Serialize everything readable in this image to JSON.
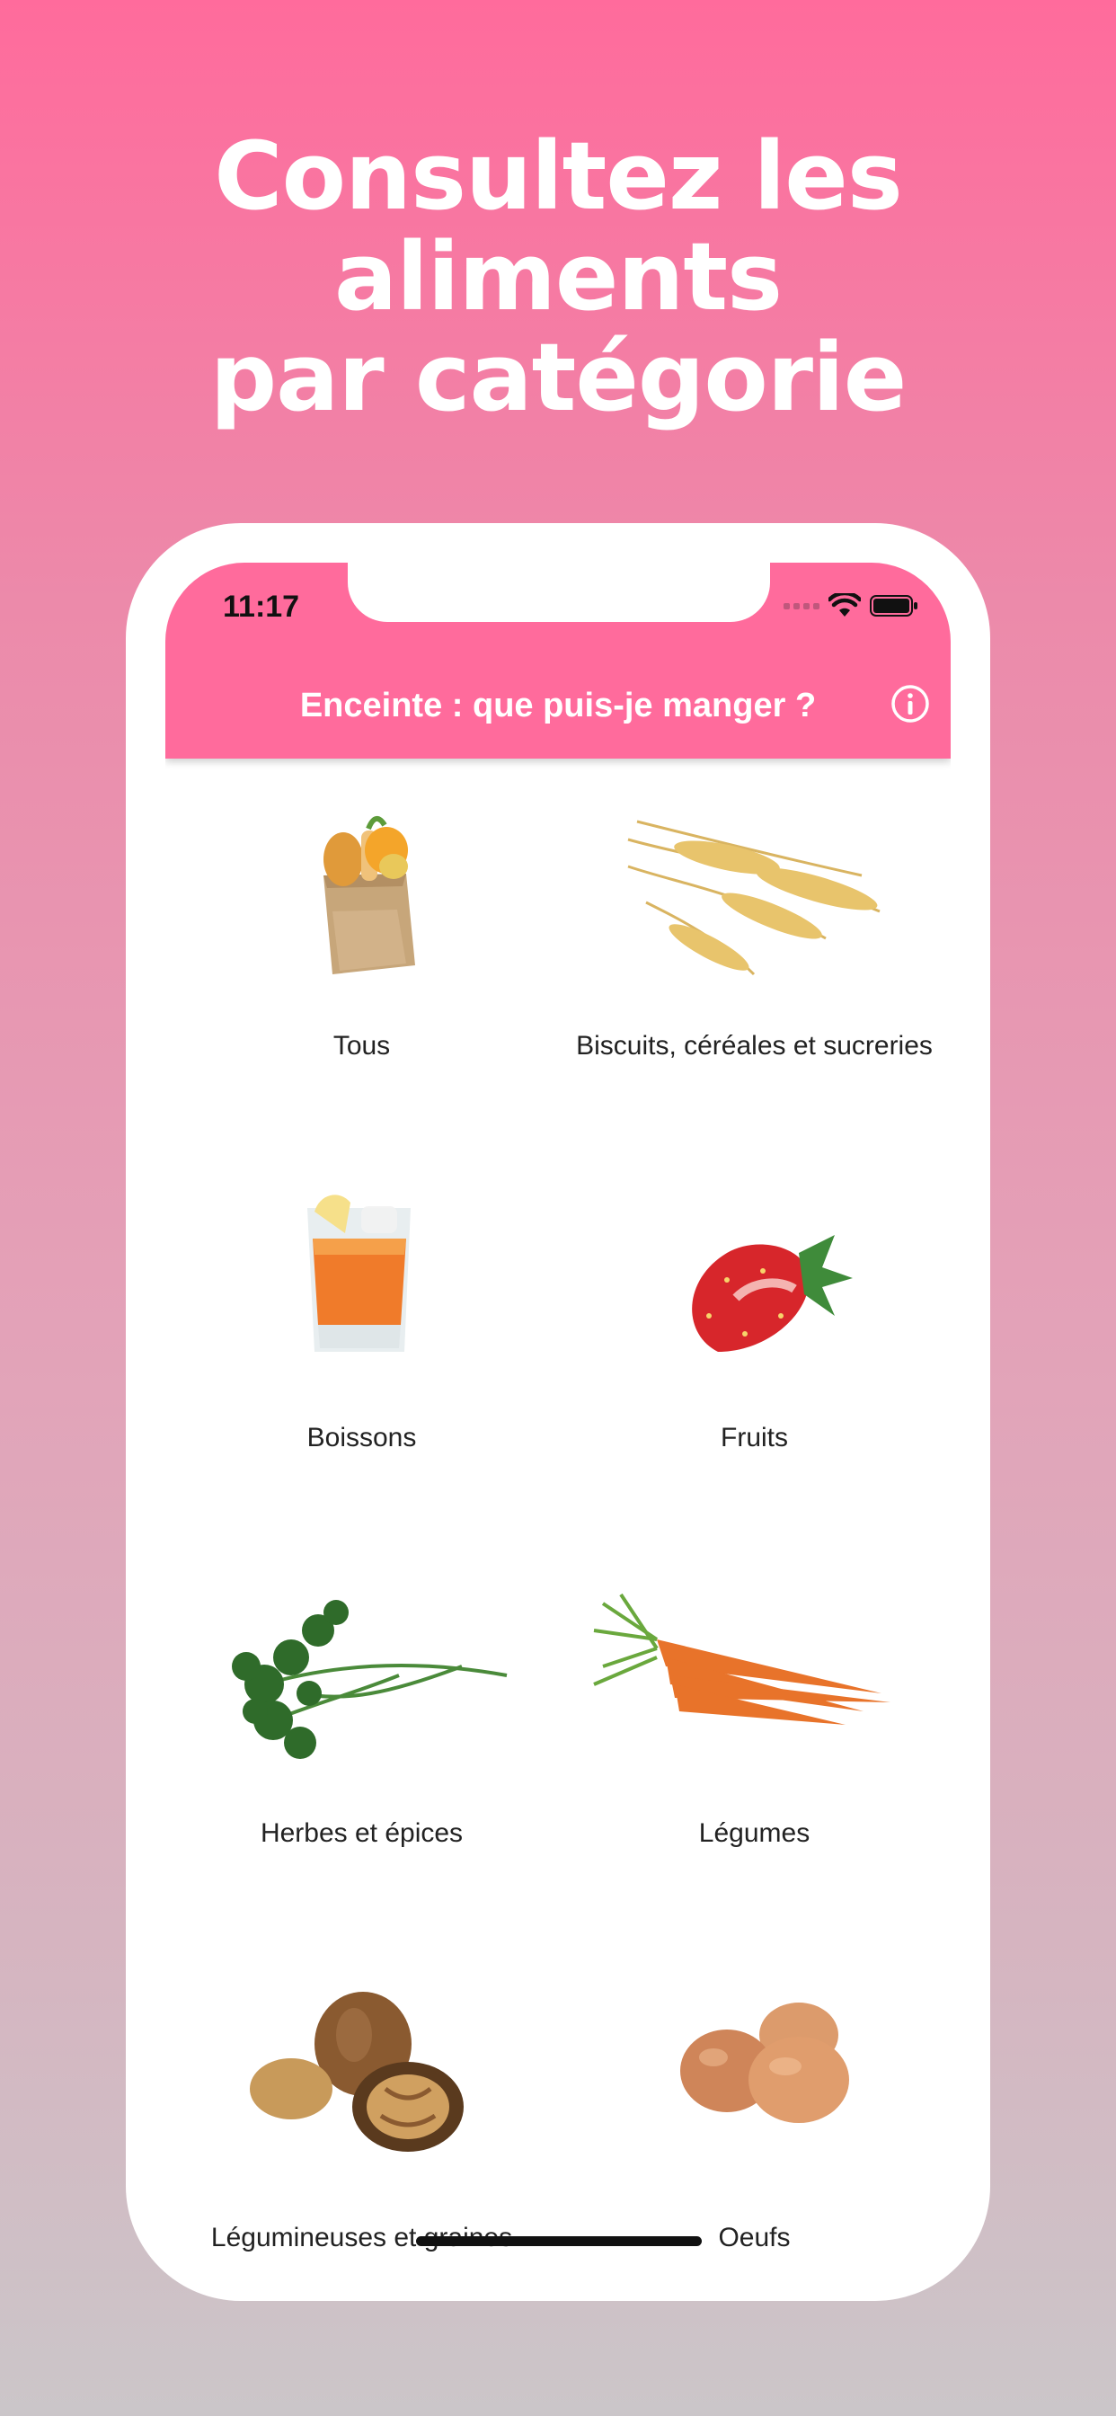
{
  "promo": {
    "line1": "Consultez les aliments",
    "line2": "par catégorie"
  },
  "status_bar": {
    "time": "11:17"
  },
  "app_bar": {
    "title": "Enceinte : que puis-je manger ?"
  },
  "categories": [
    {
      "label": "Tous",
      "icon": "grocery-bag-icon"
    },
    {
      "label": "Biscuits, céréales et sucreries",
      "icon": "wheat-icon"
    },
    {
      "label": "Boissons",
      "icon": "juice-glass-icon"
    },
    {
      "label": "Fruits",
      "icon": "strawberry-icon"
    },
    {
      "label": "Herbes et épices",
      "icon": "parsley-icon"
    },
    {
      "label": "Légumes",
      "icon": "carrot-icon"
    },
    {
      "label": "Légumineuses et graines",
      "icon": "walnut-icon"
    },
    {
      "label": "Oeufs",
      "icon": "eggs-icon"
    }
  ],
  "colors": {
    "accent": "#ff6b9c",
    "text": "#222222"
  }
}
